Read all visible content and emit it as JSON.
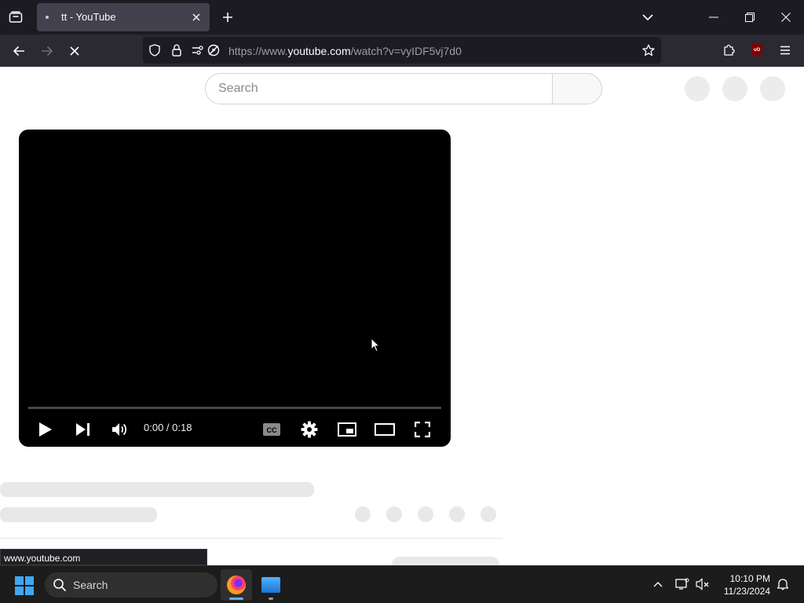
{
  "browser": {
    "tab": {
      "title": "tt - YouTube"
    },
    "url": {
      "prefix": "https://www.",
      "host": "youtube.com",
      "path": "/watch?v=vyIDF5vj7d0"
    }
  },
  "page": {
    "search": {
      "placeholder": "Search"
    },
    "player": {
      "time": "0:00 / 0:18",
      "progress": 0
    },
    "status_link": "www.youtube.com"
  },
  "taskbar": {
    "search_label": "Search",
    "time": "10:10 PM",
    "date": "11/23/2024"
  },
  "colors": {
    "chrome_dark": "#1c1b22",
    "toolbar": "#2b2a33",
    "active_tab": "#42414d",
    "skeleton": "#e8e8e8",
    "taskbar": "#1c1c1c"
  }
}
